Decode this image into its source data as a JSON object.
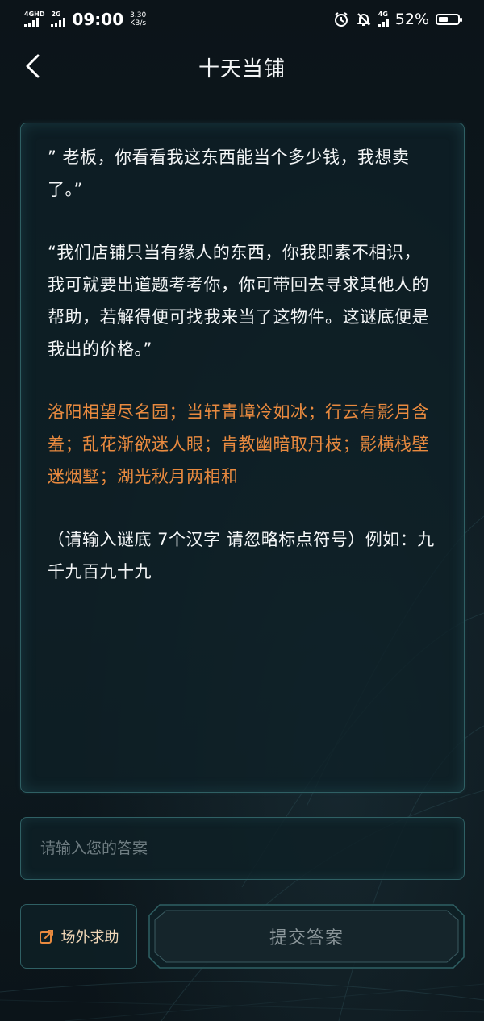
{
  "status_bar": {
    "net1": "4GHD",
    "net2": "2G",
    "time": "09:00",
    "speed_value": "3.30",
    "speed_unit": "KB/s",
    "net3": "4G",
    "battery": "52%",
    "battery_level": 0.52,
    "icons": [
      "alarm-icon",
      "mute-bell-icon",
      "signal-4g-icon",
      "battery-icon"
    ]
  },
  "nav": {
    "back_icon": "chevron-left-icon",
    "title": "十天当铺"
  },
  "card": {
    "paragraphs": [
      "” 老板，你看看我这东西能当个多少钱，我想卖了。”",
      "“我们店铺只当有缘人的东西，你我即素不相识，我可就要出道题考考你，你可带回去寻求其他人的帮助，若解得便可找我来当了这物件。这谜底便是我出的价格。”",
      "洛阳相望尽名园；当轩青嶂冷如冰；行云有影月含羞；乱花渐欲迷人眼；肯教幽暗取丹枝；影横栈壁迷烟墅；湖光秋月两相和",
      "（请输入谜底 7个汉字 请忽略标点符号）例如：九千九百九十九"
    ]
  },
  "answer": {
    "placeholder": "请输入您的答案",
    "value": ""
  },
  "buttons": {
    "help_label": "场外求助",
    "help_icon": "share-icon",
    "submit_label": "提交答案"
  },
  "colors": {
    "accent_orange": "#e98a3f",
    "border_teal": "#2f6064",
    "background": "#0b1318"
  }
}
